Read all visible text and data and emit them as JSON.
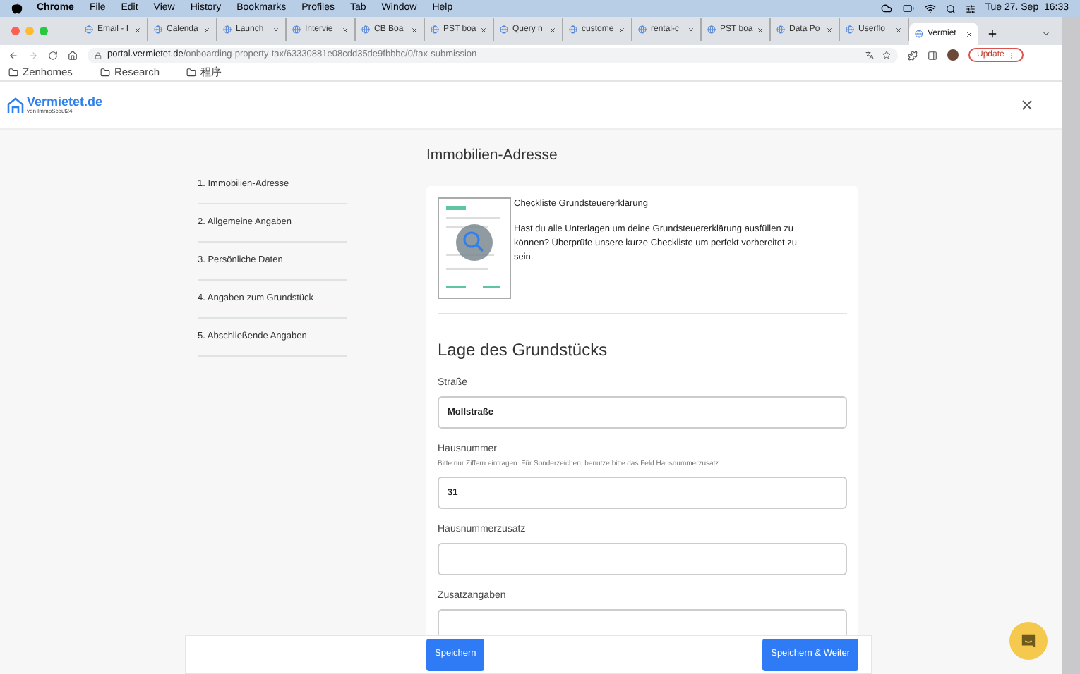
{
  "menu_bar": {
    "app": "Chrome",
    "items": [
      "File",
      "Edit",
      "View",
      "History",
      "Bookmarks",
      "Profiles",
      "Tab",
      "Window",
      "Help"
    ],
    "clock": "Tue 27. Sep  16:33"
  },
  "tabs": [
    {
      "title": "Email - I",
      "selected": false
    },
    {
      "title": "Calenda",
      "selected": false
    },
    {
      "title": "Launch",
      "selected": false
    },
    {
      "title": "Intervie",
      "selected": false
    },
    {
      "title": "CB Boa",
      "selected": false
    },
    {
      "title": "PST boa",
      "selected": false
    },
    {
      "title": "Query n",
      "selected": false
    },
    {
      "title": "custome",
      "selected": false
    },
    {
      "title": "rental-c",
      "selected": false
    },
    {
      "title": "PST boa",
      "selected": false
    },
    {
      "title": "Data Po",
      "selected": false
    },
    {
      "title": "Userflo",
      "selected": false
    },
    {
      "title": "Vermiet",
      "selected": true
    }
  ],
  "toolbar": {
    "url_host": "portal.vermietet.de",
    "url_path": "/onboarding-property-tax/63330881e08cdd35de9fbbbc/0/tax-submission",
    "update_button": "Update"
  },
  "bookmarks": [
    "Zenhomes",
    "Research",
    "程序"
  ],
  "site_header": {
    "logo": "Vermietet.de",
    "logo_subtitle": "von ImmoScout24"
  },
  "steps": [
    "1. Immobilien-Adresse",
    "2. Allgemeine Angaben",
    "3. Persönliche Daten",
    "4. Angaben zum Grundstück",
    "5. Abschließende Angaben"
  ],
  "page_title": "Immobilien-Adresse",
  "checklist": {
    "title": "Checkliste Grundsteuererklärung",
    "text": "Hast du alle Unterlagen um deine Grundsteuererklärung ausfüllen zu können? Überprüfe unsere kurze Checkliste um perfekt vorbereitet zu sein."
  },
  "section_title": "Lage des Grundstücks",
  "fields": [
    {
      "label": "Straße",
      "value": "Mollstraße"
    },
    {
      "label": "Hausnummer",
      "hint": "Bitte nur Ziffern eintragen. Für Sonderzeichen, benutze bitte das Feld Hausnummerzusatz.",
      "value": "31"
    },
    {
      "label": "Hausnummerzusatz"
    },
    {
      "label": "Zusatzangaben"
    }
  ],
  "footer_buttons": [
    "Speichern",
    "Speichern & Weiter"
  ]
}
